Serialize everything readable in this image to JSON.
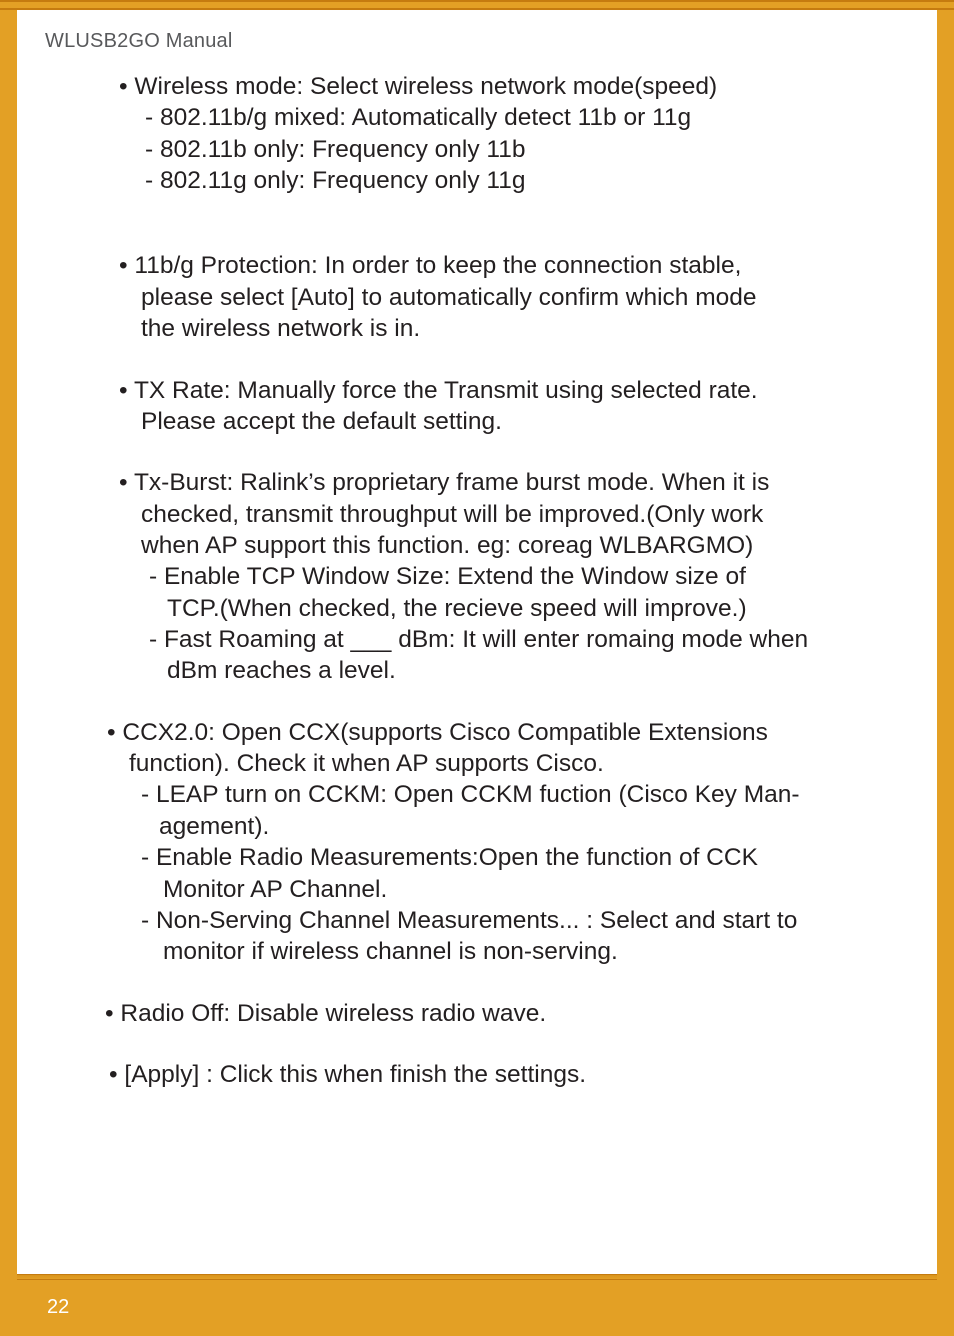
{
  "header": {
    "title": "WLUSB2GO  Manual"
  },
  "page_number": "22",
  "body": {
    "wireless_mode_intro": "•  Wireless mode: Select wireless network mode(speed)",
    "wireless_mode_a": "- 802.11b/g mixed: Automatically detect 11b or 11g",
    "wireless_mode_b": "- 802.11b only: Frequency only 11b",
    "wireless_mode_c": "- 802.11g only: Frequency only 11g",
    "protection_l1": "• 11b/g Protection: In order to keep the connection stable,",
    "protection_l2": "please select [Auto] to automatically confirm which mode",
    "protection_l3": "the wireless network is in.",
    "txrate_l1": "• TX Rate: Manually force the Transmit using selected rate.",
    "txrate_l2": "Please accept the default setting.",
    "txburst_l1": "• Tx-Burst: Ralink’s proprietary frame burst mode. When it is",
    "txburst_l2": "checked, transmit throughput will be improved.(Only work",
    "txburst_l3": "when AP support this function. eg: coreag WLBARGMO)",
    "txburst_sub1_l1": "- Enable TCP Window Size: Extend the Window size of",
    "txburst_sub1_l2": "TCP.(When checked, the recieve speed will improve.)",
    "txburst_sub2_l1": "- Fast Roaming at ___ dBm: It will enter romaing mode when",
    "txburst_sub2_l2": "dBm reaches a level.",
    "ccx_l1": " • CCX2.0: Open CCX(supports Cisco Compatible Extensions",
    "ccx_l2": "function). Check it when AP supports Cisco.",
    "ccx_sub1_l1": "- LEAP turn on CCKM: Open CCKM fuction (Cisco Key Man-",
    "ccx_sub1_l2": "agement).",
    "ccx_sub2_l1": "- Enable Radio Measurements:Open the function of CCK",
    "ccx_sub2_l2": "Monitor AP Channel.",
    "ccx_sub3_l1": "- Non-Serving Channel Measurements... : Select and start to",
    "ccx_sub3_l2": "monitor if wireless channel is non-serving.",
    "radio_off": "• Radio Off: Disable wireless radio wave.",
    "apply": "• [Apply] : Click this when finish the settings."
  }
}
